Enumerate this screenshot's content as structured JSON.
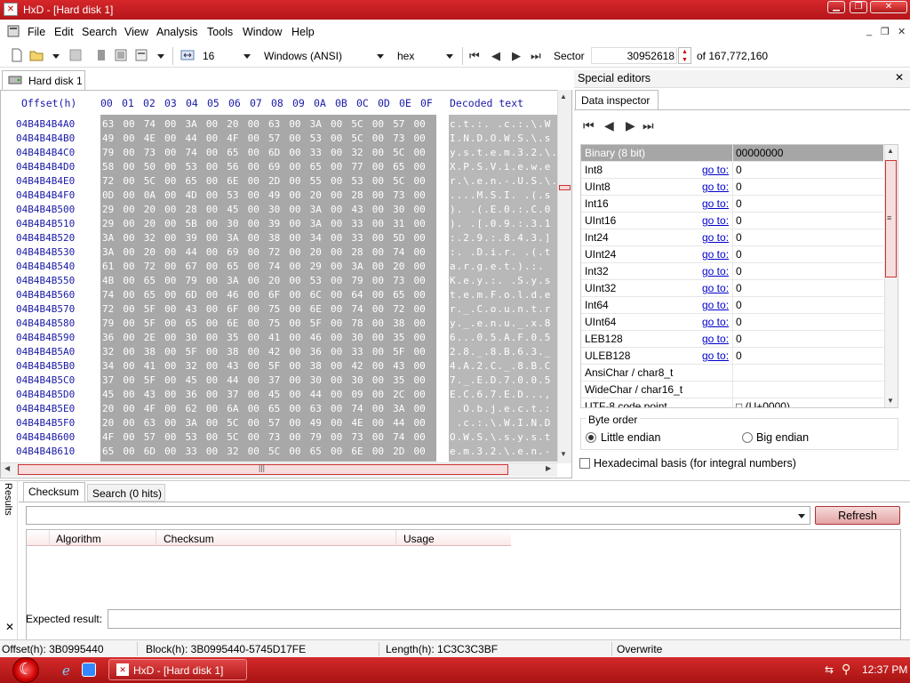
{
  "window": {
    "title": "HxD - [Hard disk 1]",
    "app_icon": "hxd-icon"
  },
  "menu": [
    "File",
    "Edit",
    "Search",
    "View",
    "Analysis",
    "Tools",
    "Window",
    "Help"
  ],
  "toolbar": {
    "bytes_per_row": "16",
    "charset": "Windows (ANSI)",
    "offset_base": "hex",
    "sector_label": "Sector",
    "sector_value": "30952618",
    "sector_total": "of 167,772,160"
  },
  "tab": {
    "label": "Hard disk 1"
  },
  "hex": {
    "offset_header": "Offset(h)",
    "columns": [
      "00",
      "01",
      "02",
      "03",
      "04",
      "05",
      "06",
      "07",
      "08",
      "09",
      "0A",
      "0B",
      "0C",
      "0D",
      "0E",
      "0F"
    ],
    "decoded_header": "Decoded text",
    "rows": [
      {
        "off": "04B4B4B4A0",
        "hex": "63 00 74 00 3A 00 20 00 63 00 3A 00 5C 00 57 00",
        "dec": "c.t.:. .c.:.\\.W"
      },
      {
        "off": "04B4B4B4B0",
        "hex": "49 00 4E 00 44 00 4F 00 57 00 53 00 5C 00 73 00",
        "dec": "I.N.D.O.W.S.\\.s"
      },
      {
        "off": "04B4B4B4C0",
        "hex": "79 00 73 00 74 00 65 00 6D 00 33 00 32 00 5C 00",
        "dec": "y.s.t.e.m.3.2.\\."
      },
      {
        "off": "04B4B4B4D0",
        "hex": "58 00 50 00 53 00 56 00 69 00 65 00 77 00 65 00",
        "dec": "X.P.S.V.i.e.w.e"
      },
      {
        "off": "04B4B4B4E0",
        "hex": "72 00 5C 00 65 00 6E 00 2D 00 55 00 53 00 5C 00",
        "dec": "r.\\.e.n.-.U.S.\\."
      },
      {
        "off": "04B4B4B4F0",
        "hex": "0D 00 0A 00 4D 00 53 00 49 00 20 00 28 00 73 00",
        "dec": "....M.S.I. .(.s"
      },
      {
        "off": "04B4B4B500",
        "hex": "29 00 20 00 28 00 45 00 30 00 3A 00 43 00 30 00",
        "dec": "). .(.E.0.:.C.0"
      },
      {
        "off": "04B4B4B510",
        "hex": "29 00 20 00 5B 00 30 00 39 00 3A 00 33 00 31 00",
        "dec": "). .[.0.9.:.3.1"
      },
      {
        "off": "04B4B4B520",
        "hex": "3A 00 32 00 39 00 3A 00 38 00 34 00 33 00 5D 00",
        "dec": ":.2.9.:.8.4.3.]"
      },
      {
        "off": "04B4B4B530",
        "hex": "3A 00 20 00 44 00 69 00 72 00 20 00 28 00 74 00",
        "dec": ":. .D.i.r. .(.t"
      },
      {
        "off": "04B4B4B540",
        "hex": "61 00 72 00 67 00 65 00 74 00 29 00 3A 00 20 00",
        "dec": "a.r.g.e.t.).:. "
      },
      {
        "off": "04B4B4B550",
        "hex": "4B 00 65 00 79 00 3A 00 20 00 53 00 79 00 73 00",
        "dec": "K.e.y.:. .S.y.s"
      },
      {
        "off": "04B4B4B560",
        "hex": "74 00 65 00 6D 00 46 00 6F 00 6C 00 64 00 65 00",
        "dec": "t.e.m.F.o.l.d.e"
      },
      {
        "off": "04B4B4B570",
        "hex": "72 00 5F 00 43 00 6F 00 75 00 6E 00 74 00 72 00",
        "dec": "r._.C.o.u.n.t.r"
      },
      {
        "off": "04B4B4B580",
        "hex": "79 00 5F 00 65 00 6E 00 75 00 5F 00 78 00 38 00",
        "dec": "y._.e.n.u._.x.8"
      },
      {
        "off": "04B4B4B590",
        "hex": "36 00 2E 00 30 00 35 00 41 00 46 00 30 00 35 00",
        "dec": "6...0.5.A.F.0.5"
      },
      {
        "off": "04B4B4B5A0",
        "hex": "32 00 38 00 5F 00 38 00 42 00 36 00 33 00 5F 00",
        "dec": "2.8._.8.B.6.3._"
      },
      {
        "off": "04B4B4B5B0",
        "hex": "34 00 41 00 32 00 43 00 5F 00 38 00 42 00 43 00",
        "dec": "4.A.2.C._.8.B.C"
      },
      {
        "off": "04B4B4B5C0",
        "hex": "37 00 5F 00 45 00 44 00 37 00 30 00 30 00 35 00",
        "dec": "7._.E.D.7.0.0.5"
      },
      {
        "off": "04B4B4B5D0",
        "hex": "45 00 43 00 36 00 37 00 45 00 44 00 09 00 2C 00",
        "dec": "E.C.6.7.E.D...,"
      },
      {
        "off": "04B4B4B5E0",
        "hex": "20 00 4F 00 62 00 6A 00 65 00 63 00 74 00 3A 00",
        "dec": " .O.b.j.e.c.t.:"
      },
      {
        "off": "04B4B4B5F0",
        "hex": "20 00 63 00 3A 00 5C 00 57 00 49 00 4E 00 44 00",
        "dec": " .c.:.\\.W.I.N.D"
      },
      {
        "off": "04B4B4B600",
        "hex": "4F 00 57 00 53 00 5C 00 73 00 79 00 73 00 74 00",
        "dec": "O.W.S.\\.s.y.s.t"
      },
      {
        "off": "04B4B4B610",
        "hex": "65 00 6D 00 33 00 32 00 5C 00 65 00 6E 00 2D 00",
        "dec": "e.m.3.2.\\.e.n.-"
      }
    ]
  },
  "special": {
    "title": "Special editors",
    "tab": "Data inspector",
    "rows": [
      {
        "name": "Binary (8 bit)",
        "goto": "",
        "val": "00000000"
      },
      {
        "name": "Int8",
        "goto": "go to:",
        "val": "0"
      },
      {
        "name": "UInt8",
        "goto": "go to:",
        "val": "0"
      },
      {
        "name": "Int16",
        "goto": "go to:",
        "val": "0"
      },
      {
        "name": "UInt16",
        "goto": "go to:",
        "val": "0"
      },
      {
        "name": "Int24",
        "goto": "go to:",
        "val": "0"
      },
      {
        "name": "UInt24",
        "goto": "go to:",
        "val": "0"
      },
      {
        "name": "Int32",
        "goto": "go to:",
        "val": "0"
      },
      {
        "name": "UInt32",
        "goto": "go to:",
        "val": "0"
      },
      {
        "name": "Int64",
        "goto": "go to:",
        "val": "0"
      },
      {
        "name": "UInt64",
        "goto": "go to:",
        "val": "0"
      },
      {
        "name": "LEB128",
        "goto": "go to:",
        "val": "0"
      },
      {
        "name": "ULEB128",
        "goto": "go to:",
        "val": "0"
      },
      {
        "name": "AnsiChar / char8_t",
        "goto": "",
        "val": ""
      },
      {
        "name": "WideChar / char16_t",
        "goto": "",
        "val": ""
      },
      {
        "name": "UTF-8 code point",
        "goto": "",
        "val": "□ (U+0000)"
      }
    ],
    "byte_order_label": "Byte order",
    "little_endian": "Little endian",
    "big_endian": "Big endian",
    "hex_basis": "Hexadecimal basis (for integral numbers)"
  },
  "results": {
    "side_label": "Results",
    "tab_checksum": "Checksum",
    "tab_search": "Search (0 hits)",
    "refresh": "Refresh",
    "col_algorithm": "Algorithm",
    "col_checksum": "Checksum",
    "col_usage": "Usage",
    "expected_label": "Expected result:"
  },
  "status": {
    "offset": "Offset(h): 3B0995440",
    "block": "Block(h): 3B0995440-5745D17FE",
    "length": "Length(h): 1C3C3C3BF",
    "mode": "Overwrite"
  },
  "taskbar": {
    "task": "HxD - [Hard disk 1]",
    "clock": "12:37 PM"
  }
}
